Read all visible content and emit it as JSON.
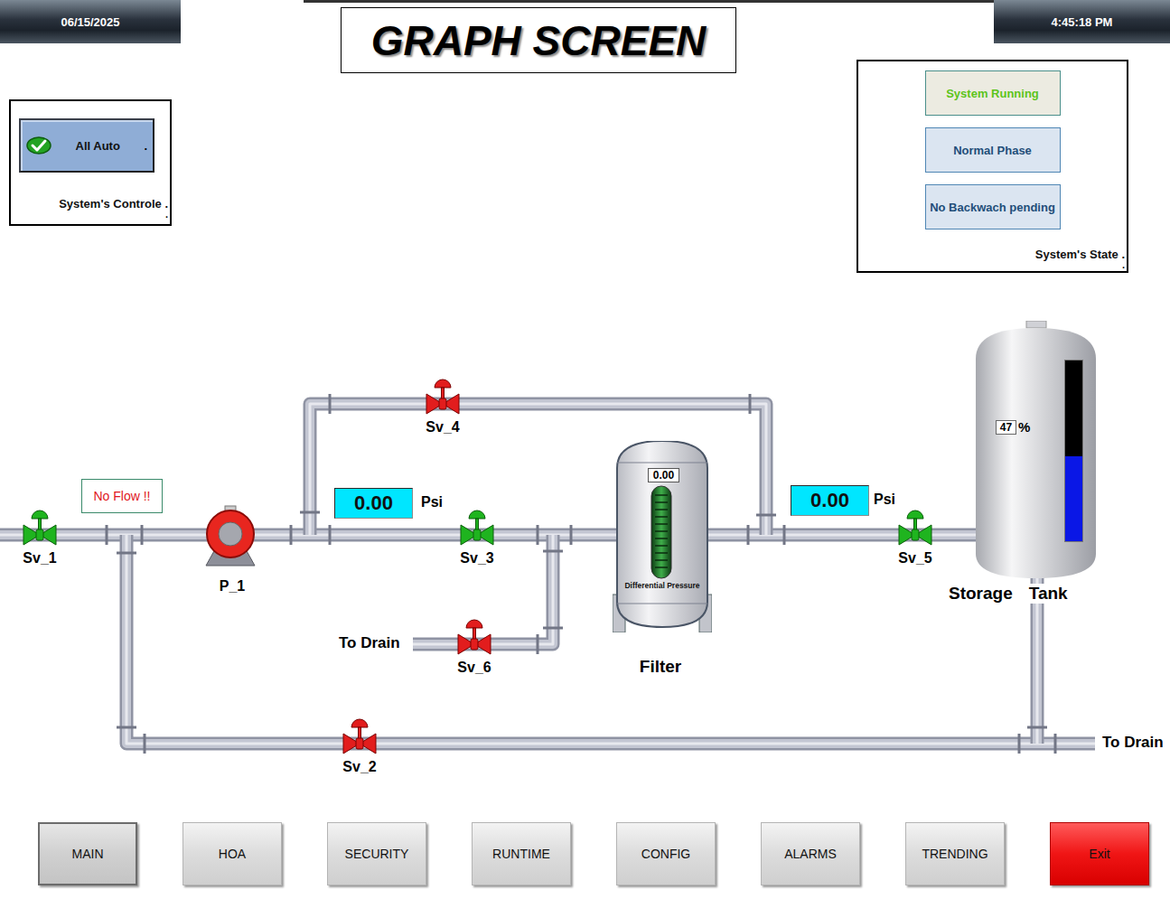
{
  "header": {
    "date": "06/15/2025",
    "title": "GRAPH SCREEN",
    "time": "4:45:18 PM"
  },
  "control_panel": {
    "label": "System's Controle .",
    "mark": ".",
    "mode_button": {
      "label": "All Auto",
      "mark": ".",
      "checked": true
    }
  },
  "state_panel": {
    "label": "System's State .",
    "mark": ".",
    "indicators": [
      {
        "label": "System Running",
        "active": true
      },
      {
        "label": "Normal Phase",
        "active": false
      },
      {
        "label": "No Backwach pending",
        "active": false
      }
    ]
  },
  "diagram": {
    "flow_alarm": "No Flow !!",
    "valves": [
      {
        "name": "Sv_1",
        "open": true
      },
      {
        "name": "Sv_2",
        "open": false
      },
      {
        "name": "Sv_3",
        "open": true
      },
      {
        "name": "Sv_4",
        "open": false
      },
      {
        "name": "Sv_5",
        "open": true
      },
      {
        "name": "Sv_6",
        "open": false
      }
    ],
    "pump": {
      "name": "P_1",
      "running": false
    },
    "pressures": [
      {
        "value": "0.00",
        "unit": "Psi"
      },
      {
        "value": "0.00",
        "unit": "Psi"
      }
    ],
    "filter": {
      "name": "Filter",
      "reading": "0.00",
      "gauge_label": "Differential Pressure"
    },
    "tank": {
      "name_parts": [
        "Storage",
        "Tank"
      ],
      "reading": "47",
      "unit": "%",
      "level": 0.47
    },
    "drains": [
      "To Drain",
      "To Drain"
    ]
  },
  "nav": [
    {
      "label": "MAIN",
      "kind": "page",
      "selected": true
    },
    {
      "label": "HOA",
      "kind": "page",
      "selected": false
    },
    {
      "label": "SECURITY",
      "kind": "page",
      "selected": false
    },
    {
      "label": "RUNTIME",
      "kind": "page",
      "selected": false
    },
    {
      "label": "CONFIG",
      "kind": "page",
      "selected": false
    },
    {
      "label": "ALARMS",
      "kind": "page",
      "selected": false
    },
    {
      "label": "TRENDING",
      "kind": "page",
      "selected": false
    },
    {
      "label": "Exit",
      "kind": "exit",
      "selected": false
    }
  ]
}
